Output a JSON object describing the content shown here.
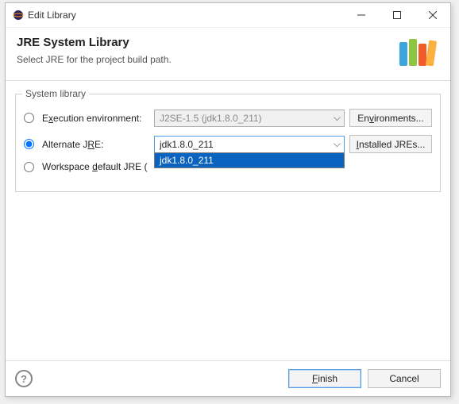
{
  "window": {
    "title": "Edit Library"
  },
  "header": {
    "title": "JRE System Library",
    "subtitle": "Select JRE for the project build path."
  },
  "group": {
    "label": "System library",
    "execution_env": {
      "radio_pre": "E",
      "radio_mid": "x",
      "radio_post": "ecution environment:",
      "value": "J2SE-1.5 (jdk1.8.0_211)",
      "button_pre": "En",
      "button_mid": "v",
      "button_post": "ironments..."
    },
    "alternate": {
      "radio_pre": "Alternate J",
      "radio_mid": "R",
      "radio_post": "E:",
      "value": "jdk1.8.0_211",
      "option0": "jdk1.8.0_211",
      "button_mid": "I",
      "button_post": "nstalled JREs..."
    },
    "workspace": {
      "radio_pre": "Workspace ",
      "radio_mid": "d",
      "radio_post": "efault JRE ("
    }
  },
  "footer": {
    "finish_mid": "F",
    "finish_post": "inish",
    "cancel": "Cancel"
  }
}
